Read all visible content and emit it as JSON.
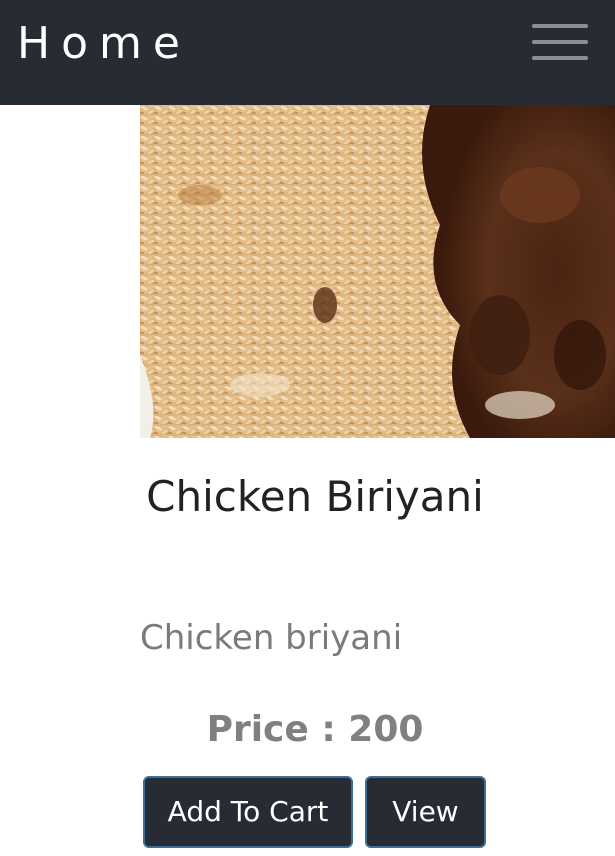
{
  "navbar": {
    "brand": "Home",
    "menu_icon": "hamburger-menu-icon"
  },
  "product": {
    "image_alt": "chicken-biriyani-photo",
    "name": "Chicken Biriyani",
    "description": "Chicken briyani",
    "price_text": "Price : 200"
  },
  "actions": {
    "add_to_cart_label": "Add To Cart",
    "view_label": "View"
  },
  "colors": {
    "navbar_bg": "#272b33",
    "button_bg": "#272b33",
    "button_border": "#3b6f94",
    "muted_text": "#7a7a7a"
  }
}
